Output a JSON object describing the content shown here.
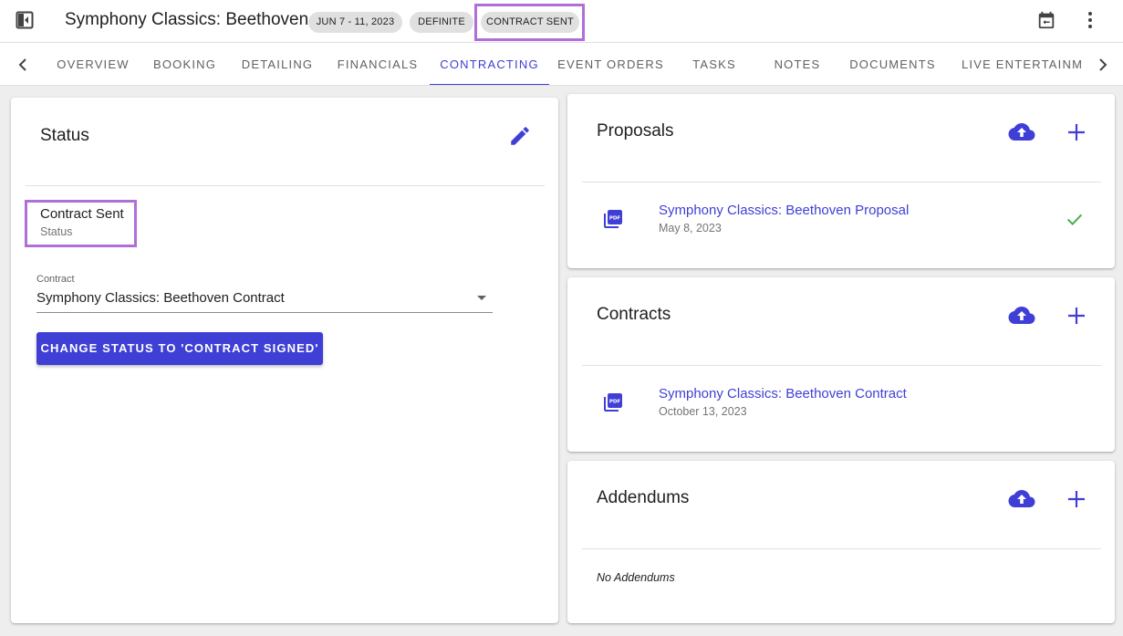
{
  "header": {
    "title": "Symphony Classics: Beethoven",
    "chips": {
      "date": "JUN 7 - 11, 2023",
      "status": "DEFINITE",
      "stage": "CONTRACT SENT"
    },
    "icons": [
      "sidebar-toggle-icon",
      "calendar-icon",
      "more-vert-icon"
    ]
  },
  "tabs": {
    "items": [
      {
        "label": "OVERVIEW"
      },
      {
        "label": "BOOKING"
      },
      {
        "label": "DETAILING"
      },
      {
        "label": "FINANCIALS"
      },
      {
        "label": "CONTRACTING"
      },
      {
        "label": "EVENT ORDERS"
      },
      {
        "label": "TASKS"
      },
      {
        "label": "NOTES"
      },
      {
        "label": "DOCUMENTS"
      },
      {
        "label": "LIVE ENTERTAINME"
      }
    ],
    "active": "CONTRACTING"
  },
  "status_card": {
    "title": "Status",
    "status_value": "Contract Sent",
    "status_label": "Status",
    "contract_label": "Contract",
    "contract_value": "Symphony Classics: Beethoven Contract",
    "action_button": "CHANGE STATUS TO 'CONTRACT SIGNED'"
  },
  "proposals": {
    "title": "Proposals",
    "items": [
      {
        "name": "Symphony Classics: Beethoven Proposal",
        "date": "May 8, 2023",
        "accepted": true
      }
    ]
  },
  "contracts": {
    "title": "Contracts",
    "items": [
      {
        "name": "Symphony Classics: Beethoven Contract",
        "date": "October 13, 2023"
      }
    ]
  },
  "addendums": {
    "title": "Addendums",
    "empty_text": "No Addendums"
  },
  "colors": {
    "accent": "#3f3fd6",
    "highlight": "#b06fd8",
    "chip": "#e0e0e0",
    "success": "#4caf50"
  }
}
